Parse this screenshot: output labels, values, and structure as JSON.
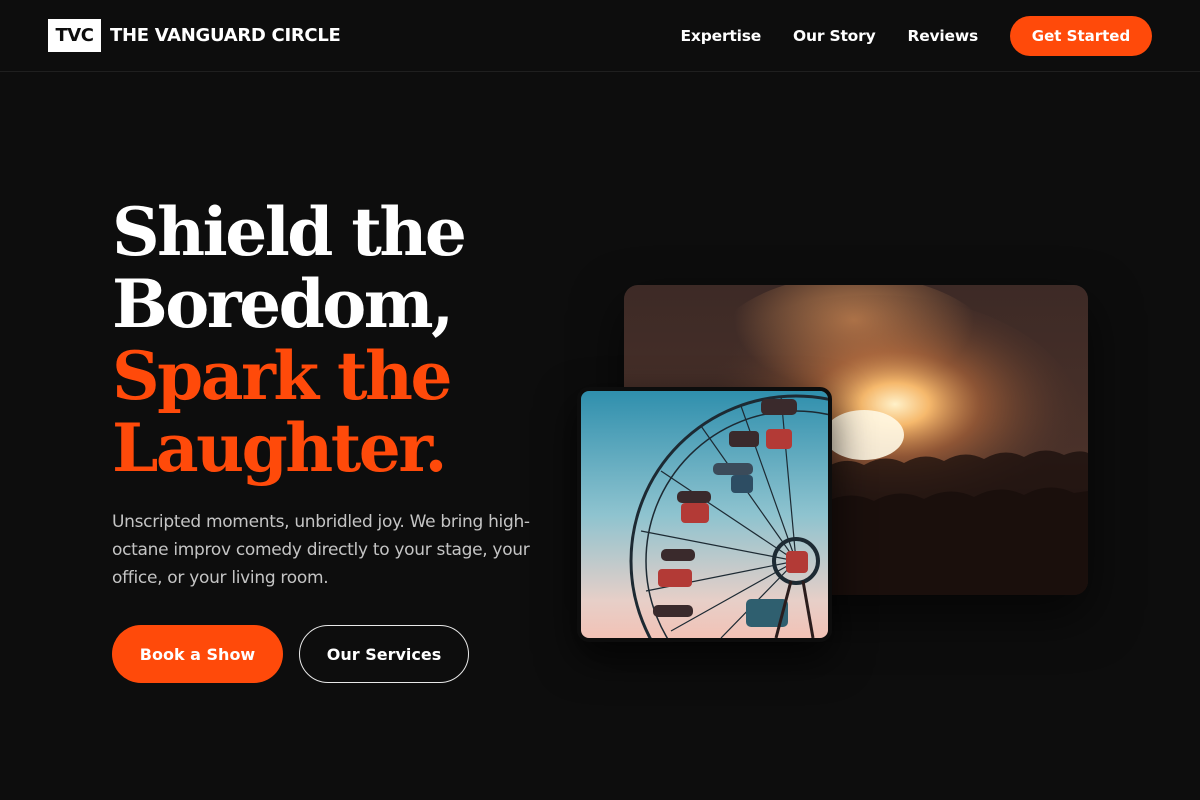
{
  "brand": {
    "badge": "TVC",
    "name": "THE VANGUARD CIRCLE"
  },
  "nav": {
    "links": [
      "Expertise",
      "Our Story",
      "Reviews"
    ],
    "cta": "Get Started"
  },
  "hero": {
    "title_lines_white": [
      "Shield the",
      "Boredom,"
    ],
    "title_lines_accent": [
      "Spark the",
      "Laughter."
    ],
    "description": "Unscripted moments, unbridled joy. We bring high-octane improv comedy directly to your stage, your office, or your living room.",
    "primary_button": "Book a Show",
    "secondary_button": "Our Services"
  },
  "images": {
    "concert": "concert-crowd-photo",
    "ferris": "ferris-wheel-photo"
  },
  "colors": {
    "background": "#0d0d0d",
    "accent": "#ff4a0a",
    "text": "#ffffff",
    "muted_text": "#c4c4c4"
  }
}
